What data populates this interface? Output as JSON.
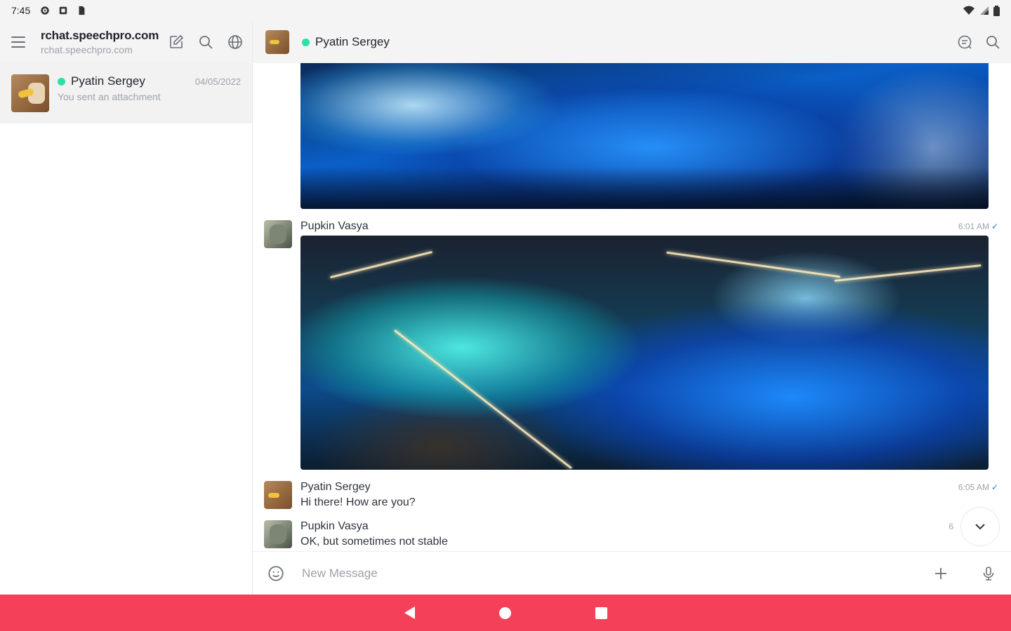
{
  "status_bar": {
    "time": "7:45"
  },
  "sidebar": {
    "server_name": "rchat.speechpro.com",
    "server_url": "rchat.speechpro.com",
    "rooms": [
      {
        "name": "Pyatin Sergey",
        "date": "04/05/2022",
        "last_message": "You sent an attachment",
        "status": "online"
      }
    ]
  },
  "room_header": {
    "title": "Pyatin Sergey",
    "status": "online"
  },
  "messages": [
    {
      "user": "Pupkin Vasya",
      "time": "6:01 AM",
      "attachment": "image"
    },
    {
      "user": "Pyatin Sergey",
      "time": "6:05 AM",
      "text": "Hi there! How are you?"
    },
    {
      "user": "Pupkin Vasya",
      "time": "6",
      "text": "OK, but sometimes not stable"
    }
  ],
  "composer": {
    "placeholder": "New Message"
  },
  "colors": {
    "online": "#2de0a5",
    "navbar": "#f5405a",
    "tick": "#1d74f5"
  },
  "icons": [
    "menu-icon",
    "edit-icon",
    "search-icon",
    "globe-icon",
    "threads-icon",
    "emoji-icon",
    "plus-icon",
    "mic-icon",
    "chevron-down-icon"
  ]
}
